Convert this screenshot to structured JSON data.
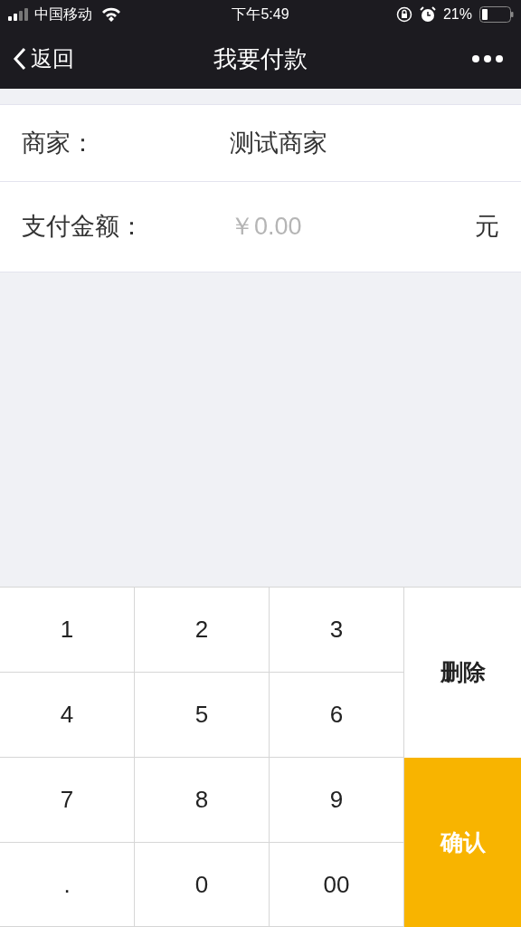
{
  "status_bar": {
    "carrier": "中国移动",
    "time": "下午5:49",
    "battery": "21%"
  },
  "nav": {
    "back": "返回",
    "title": "我要付款"
  },
  "form": [
    {
      "kind": "text",
      "label": "商家：",
      "value": "测试商家"
    },
    {
      "kind": "amount",
      "label": "支付金额：",
      "placeholder": "￥0.00",
      "unit": "元"
    }
  ],
  "keypad": {
    "keys": [
      "1",
      "2",
      "3",
      "4",
      "5",
      "6",
      "7",
      "8",
      "9",
      ".",
      "0",
      "00"
    ],
    "actions": [
      {
        "kind": "delete",
        "label": "删除"
      },
      {
        "kind": "confirm",
        "label": "确认"
      }
    ]
  }
}
